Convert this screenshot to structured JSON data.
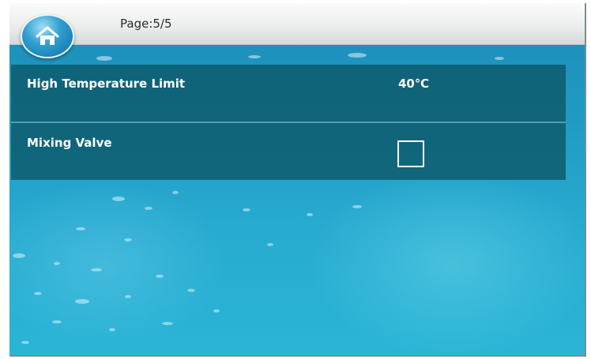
{
  "header": {
    "home_icon": "home-icon",
    "page_label": "Page:5/5"
  },
  "settings": [
    {
      "label": "High Temperature Limit",
      "value": "40℃"
    },
    {
      "label": "Mixing Valve",
      "checked": false
    }
  ],
  "colors": {
    "background": "#1f99c3",
    "panel": "#0e5c6e",
    "text": "#ffffff"
  }
}
